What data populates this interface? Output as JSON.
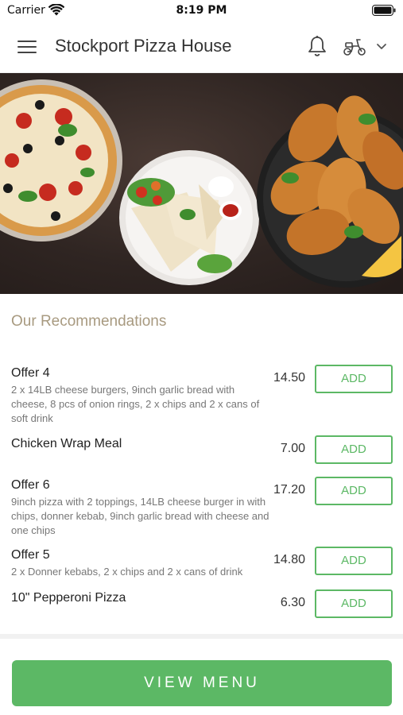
{
  "status_bar": {
    "carrier": "Carrier",
    "time": "8:19 PM"
  },
  "header": {
    "title": "Stockport Pizza House",
    "icons": [
      "menu-icon",
      "bell-icon",
      "scooter-icon",
      "chevron-down-icon"
    ]
  },
  "hero": {
    "icon": "food-banner-image"
  },
  "recommendations": {
    "title": "Our Recommendations",
    "items": [
      {
        "name": "Offer 4",
        "description": "2 x 14LB cheese burgers, 9inch garlic bread with cheese, 8 pcs of onion rings, 2 x chips and 2 x cans of soft drink",
        "price": "14.50",
        "button": "ADD"
      },
      {
        "name": "Chicken Wrap Meal",
        "description": "",
        "price": "7.00",
        "button": "ADD"
      },
      {
        "name": "Offer 6",
        "description": "9inch pizza with 2 toppings, 14LB cheese burger in with chips, donner kebab, 9inch garlic bread with cheese and one chips",
        "price": "17.20",
        "button": "ADD"
      },
      {
        "name": "Offer 5",
        "description": "2 x Donner kebabs, 2 x chips and 2 x cans of drink",
        "price": "14.80",
        "button": "ADD"
      },
      {
        "name": "10\" Pepperoni Pizza",
        "description": "",
        "price": "6.30",
        "button": "ADD"
      }
    ]
  },
  "footer": {
    "view_menu_label": "VIEW MENU"
  },
  "colors": {
    "accent_green": "#5cb865",
    "section_title": "#a89a80"
  }
}
